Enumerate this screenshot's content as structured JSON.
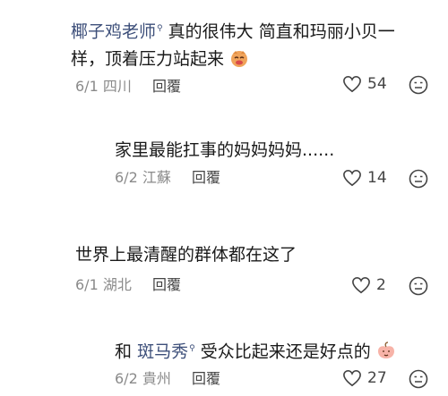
{
  "comments": [
    {
      "author": "椰子鸡老师",
      "text_line1": "真的很伟大 简直和玛丽小贝一",
      "text_line2": "样，顶着压力站起来",
      "date": "6/1",
      "location": "四川",
      "reply_label": "回覆",
      "likes": "54",
      "emoji_icon": "tiger-face-emoji"
    },
    {
      "text": "家里最能扛事的妈妈妈妈......",
      "date": "6/2",
      "location": "江蘇",
      "reply_label": "回覆",
      "likes": "14"
    },
    {
      "text": "世界上最清醒的群体都在这了",
      "date": "6/1",
      "location": "湖北",
      "reply_label": "回覆",
      "likes": "2"
    },
    {
      "prefix": "和",
      "mention": "斑马秀",
      "text": "受众比起来还是好点的",
      "date": "6/2",
      "location": "貴州",
      "reply_label": "回覆",
      "likes": "27",
      "emoji_icon": "peach-face-emoji"
    }
  ],
  "colors": {
    "name": "#3d4f7a",
    "meta": "#8a8a8a",
    "icon": "#444444"
  },
  "icons": {
    "like": "heart-outline-icon",
    "dislike": "meh-face-icon"
  }
}
